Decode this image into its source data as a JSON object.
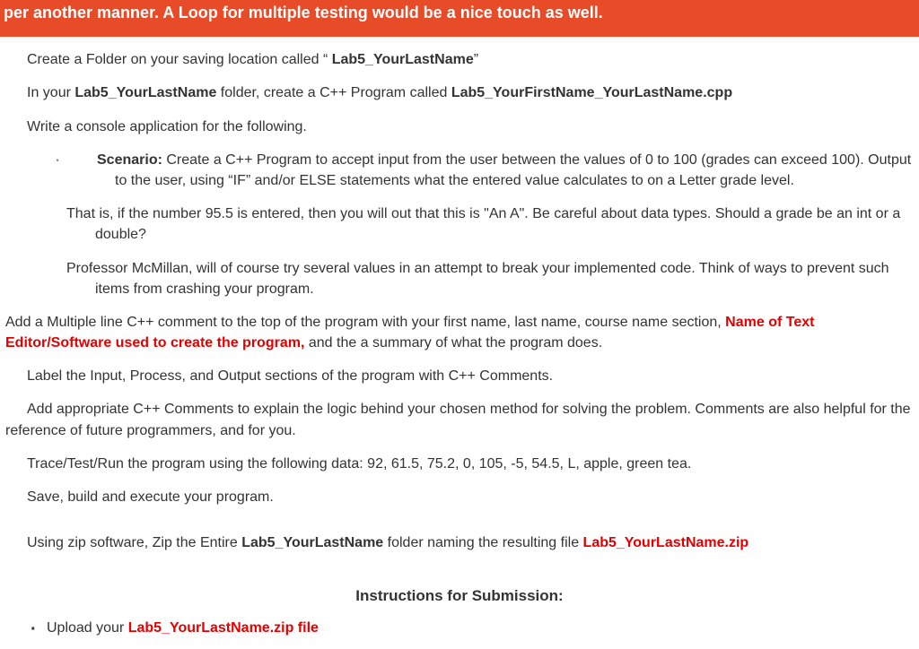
{
  "banner": {
    "text": "per another manner. A Loop for multiple testing would be a nice touch as well."
  },
  "paras": {
    "p1_a": "Create a Folder on your saving location called “ ",
    "p1_b": "Lab5_YourLastName",
    "p1_c": "”",
    "p2_a": "In your ",
    "p2_b": "Lab5_YourLastName",
    "p2_c": " folder, create a C++ Program called ",
    "p2_d": "Lab5_YourFirstName_YourLastName.cpp",
    "p3": "Write a console application for the following.",
    "scen_bullet": "·",
    "scen_label": "Scenario:",
    "scen_body": " Create a C++ Program to accept input from the user between the values of 0 to 100 (grades can exceed 100).  Output to the user, using “IF” and/or ELSE statements what the entered value calculates to on a Letter grade level.",
    "that_is": "That is, if the number 95.5 is entered, then you will out that this is \"An A\". Be careful about data types. Should a grade be an int or a double?",
    "prof": "Professor McMillan, will of course try several values in an attempt to break your implemented code.  Think of ways to prevent such items from crashing your program.",
    "addmulti_a": "Add a Multiple line C++ comment to the top of the program with your first name, last name, course name section, ",
    "addmulti_b": "Name of Text Editor/Software used to create the program,",
    "addmulti_c": " and the a summary of what the program does.",
    "label_sections": "Label the Input, Process, and Output sections of the program with C++ Comments.",
    "add_comments": "Add appropriate C++ Comments to explain the logic behind your chosen method for solving the problem. Comments are also helpful for the reference of future programmers, and for you.",
    "trace": "Trace/Test/Run the program using the following data: 92, 61.5, 75.2, 0, 105, -5, 54.5, L, apple, green tea.",
    "save": "Save, build and execute your program.",
    "zip_a": "Using zip software, Zip the Entire ",
    "zip_b": "Lab5_YourLastName",
    "zip_c": " folder naming the resulting file ",
    "zip_d": "Lab5_YourLastName.zip",
    "instr_heading": "Instructions for Submission:",
    "upload_a": "Upload your ",
    "upload_b": "Lab5_YourLastName.zip file"
  }
}
